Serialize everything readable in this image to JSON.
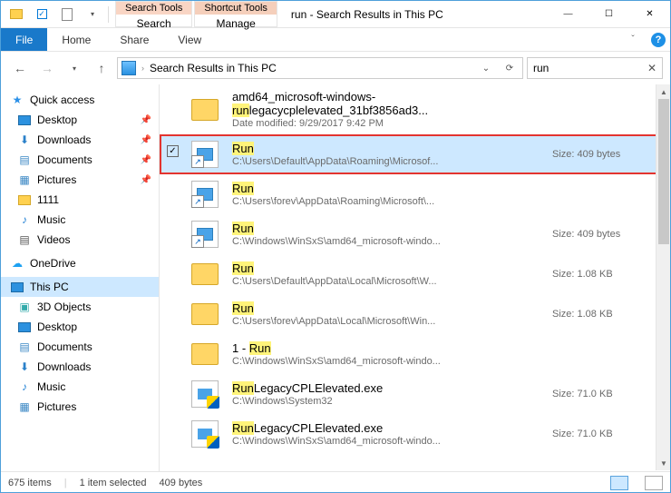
{
  "window": {
    "title": "run - Search Results in This PC",
    "tool_tabs": [
      {
        "header": "Search Tools",
        "sub": "Search"
      },
      {
        "header": "Shortcut Tools",
        "sub": "Manage"
      }
    ]
  },
  "ribbon": {
    "file": "File",
    "tabs": [
      "Home",
      "Share",
      "View"
    ]
  },
  "nav": {
    "breadcrumb": "Search Results in This PC",
    "search_value": "run"
  },
  "sidebar": {
    "quick_access": "Quick access",
    "qa_items": [
      {
        "label": "Desktop",
        "icon": "desktop"
      },
      {
        "label": "Downloads",
        "icon": "downloads"
      },
      {
        "label": "Documents",
        "icon": "documents"
      },
      {
        "label": "Pictures",
        "icon": "pictures"
      },
      {
        "label": "1111",
        "icon": "folder"
      },
      {
        "label": "Music",
        "icon": "music"
      },
      {
        "label": "Videos",
        "icon": "videos"
      }
    ],
    "onedrive": "OneDrive",
    "thispc": "This PC",
    "pc_items": [
      {
        "label": "3D Objects"
      },
      {
        "label": "Desktop"
      },
      {
        "label": "Documents"
      },
      {
        "label": "Downloads"
      },
      {
        "label": "Music"
      },
      {
        "label": "Pictures"
      }
    ]
  },
  "results": [
    {
      "type": "folder",
      "title_pre": "amd64_microsoft-windows-",
      "title_hl": "run",
      "title_post": "legacycplelevated_31bf3856ad3...",
      "sub_label": "Date modified:",
      "sub_value": "9/29/2017 9:42 PM",
      "meta": ""
    },
    {
      "type": "shortcut",
      "selected": true,
      "title_pre": "",
      "title_hl": "Run",
      "title_post": "",
      "sub_value": "C:\\Users\\Default\\AppData\\Roaming\\Microsof...",
      "meta_label": "Size:",
      "meta": "409 bytes"
    },
    {
      "type": "shortcut",
      "title_hl": "Run",
      "sub_value": "C:\\Users\\forev\\AppData\\Roaming\\Microsoft\\...",
      "meta": ""
    },
    {
      "type": "shortcut",
      "title_hl": "Run",
      "sub_value": "C:\\Windows\\WinSxS\\amd64_microsoft-windo...",
      "meta_label": "Size:",
      "meta": "409 bytes"
    },
    {
      "type": "folder",
      "title_hl": "Run",
      "sub_value": "C:\\Users\\Default\\AppData\\Local\\Microsoft\\W...",
      "meta_label": "Size:",
      "meta": "1.08 KB"
    },
    {
      "type": "folder",
      "title_hl": "Run",
      "sub_value": "C:\\Users\\forev\\AppData\\Local\\Microsoft\\Win...",
      "meta_label": "Size:",
      "meta": "1.08 KB"
    },
    {
      "type": "folder",
      "title_pre": "1 - ",
      "title_hl": "Run",
      "sub_value": "C:\\Windows\\WinSxS\\amd64_microsoft-windo...",
      "meta": ""
    },
    {
      "type": "exe",
      "title_hl": "Run",
      "title_post": "LegacyCPLElevated.exe",
      "sub_value": "C:\\Windows\\System32",
      "meta_label": "Size:",
      "meta": "71.0 KB"
    },
    {
      "type": "exe",
      "title_hl": "Run",
      "title_post": "LegacyCPLElevated.exe",
      "sub_value": "C:\\Windows\\WinSxS\\amd64_microsoft-windo...",
      "meta_label": "Size:",
      "meta": "71.0 KB"
    }
  ],
  "status": {
    "count": "675 items",
    "selection": "1 item selected",
    "size": "409 bytes"
  }
}
